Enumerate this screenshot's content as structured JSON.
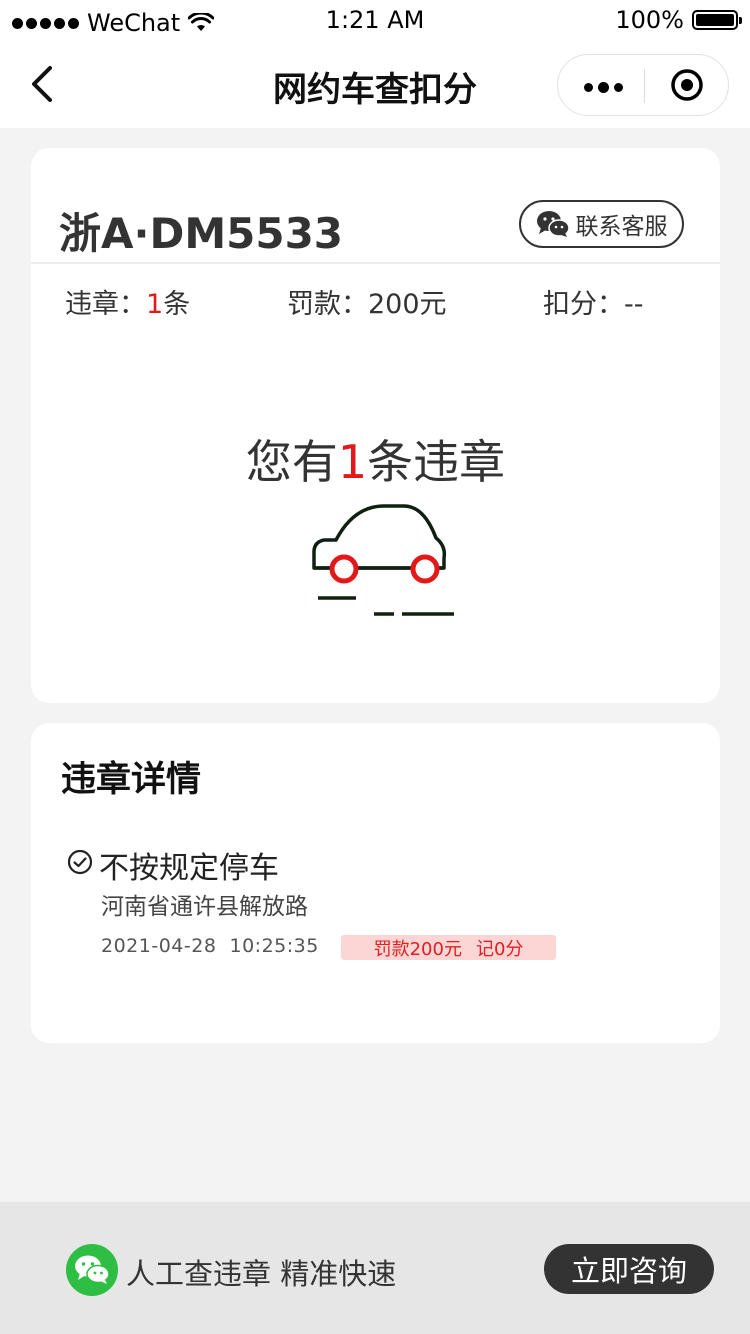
{
  "status": {
    "carrier": "WeChat",
    "time": "1:21 AM",
    "battery": "100%"
  },
  "nav": {
    "title": "网约车查扣分"
  },
  "vehicle": {
    "plate": "浙A·DM5533",
    "service_label": "联系客服",
    "violations_label": "违章：",
    "violations_count": "1",
    "violations_unit": "条",
    "fine_label": "罚款：",
    "fine_value": "200元",
    "points_label": "扣分：",
    "points_value": "--",
    "summary_prefix": "您有",
    "summary_count": "1",
    "summary_suffix": "条违章"
  },
  "details": {
    "title": "违章详情",
    "items": [
      {
        "name": "不按规定停车",
        "address": "河南省通许县解放路",
        "datetime": "2021-04-28  10:25:35",
        "fine": "罚款200元",
        "points": "记0分"
      }
    ]
  },
  "bottom": {
    "promo": "人工查违章 精准快速",
    "button": "立即咨询"
  },
  "colors": {
    "accent_red": "#e31818",
    "wechat_green": "#2dbe43",
    "tag_bg": "#fcd5d5",
    "dark_button": "#333333"
  }
}
